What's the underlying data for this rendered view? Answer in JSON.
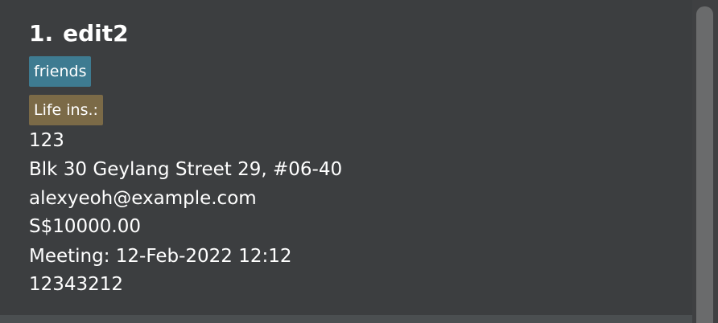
{
  "person": {
    "index": "1.",
    "name": "edit2",
    "tags": [
      "friends"
    ],
    "insurance_label": "Life ins.:",
    "phone": "123",
    "address": "Blk 30 Geylang Street 29, #06-40",
    "email": "alexyeoh@example.com",
    "amount": "S$10000.00",
    "meeting": "Meeting: 12-Feb-2022 12:12",
    "policy_number": "12343212"
  },
  "colors": {
    "background": "#3f4042",
    "tag_friends": "#3e7b91",
    "tag_insurance": "#7b6a47",
    "scrollbar_thumb": "#6a6b6c"
  }
}
